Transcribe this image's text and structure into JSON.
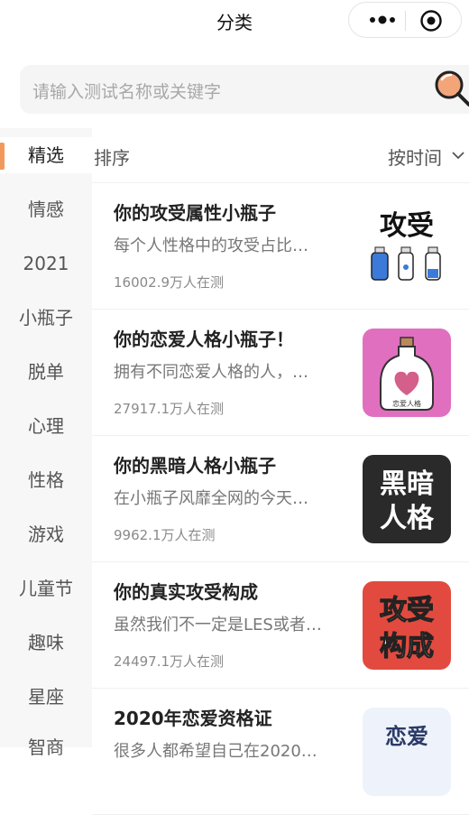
{
  "header": {
    "title": "分类"
  },
  "search": {
    "placeholder": "请输入测试名称或关键字"
  },
  "sidebar": {
    "items": [
      {
        "label": "精选",
        "active": true
      },
      {
        "label": "情感"
      },
      {
        "label": "2021"
      },
      {
        "label": "小瓶子"
      },
      {
        "label": "脱单"
      },
      {
        "label": "心理"
      },
      {
        "label": "性格"
      },
      {
        "label": "游戏"
      },
      {
        "label": "儿童节"
      },
      {
        "label": "趣味"
      },
      {
        "label": "星座"
      },
      {
        "label": "智商"
      }
    ]
  },
  "sort": {
    "label": "排序",
    "value": "按时间"
  },
  "list": [
    {
      "title": "你的攻受属性小瓶子",
      "desc": "每个人性格中的攻受占比…",
      "count": "16002.9万人在测",
      "thumb_text": "攻受"
    },
    {
      "title": "你的恋爱人格小瓶子！",
      "desc": "拥有不同恋爱人格的人，…",
      "count": "27917.1万人在测",
      "thumb_text": "恋爱人格"
    },
    {
      "title": "你的黑暗人格小瓶子",
      "desc": "在小瓶子风靡全网的今天…",
      "count": "9962.1万人在测",
      "thumb_text": [
        "黑暗",
        "人格"
      ]
    },
    {
      "title": "你的真实攻受构成",
      "desc": "虽然我们不一定是LES或者…",
      "count": "24497.1万人在测",
      "thumb_text": [
        "攻受",
        "构成"
      ]
    },
    {
      "title": "2020年恋爱资格证",
      "desc": "很多人都希望自己在2020…",
      "count": "",
      "thumb_text": "恋爱"
    }
  ],
  "colors": {
    "accent": "#f1995d",
    "pink_bg": "#e06fc0",
    "dark_bg": "#2a2a2a",
    "red_bg": "#e34a3f"
  }
}
